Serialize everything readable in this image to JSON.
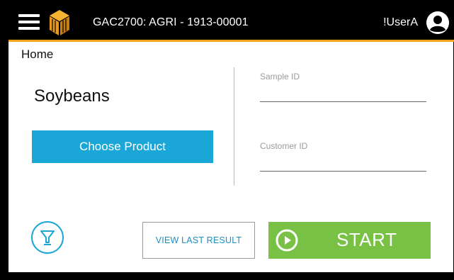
{
  "header": {
    "title": "GAC2700: AGRI - 1913-00001",
    "username": "!UserA",
    "accent_color": "#f0a21a",
    "icons": {
      "menu": "hamburger-menu-icon",
      "logo": "cube-logo",
      "user": "account-circle-icon"
    }
  },
  "breadcrumb": "Home",
  "product": {
    "name": "Soybeans",
    "choose_label": "Choose Product"
  },
  "fields": {
    "sample_id": {
      "label": "Sample ID",
      "value": ""
    },
    "customer_id": {
      "label": "Customer ID",
      "value": ""
    }
  },
  "actions": {
    "filter_icon": "funnel-filter-icon",
    "view_last_result": "VIEW LAST RESULT",
    "start": "START",
    "start_icon": "play-circle-icon"
  },
  "colors": {
    "primary_blue": "#1aa7d8",
    "start_green": "#79c145"
  }
}
